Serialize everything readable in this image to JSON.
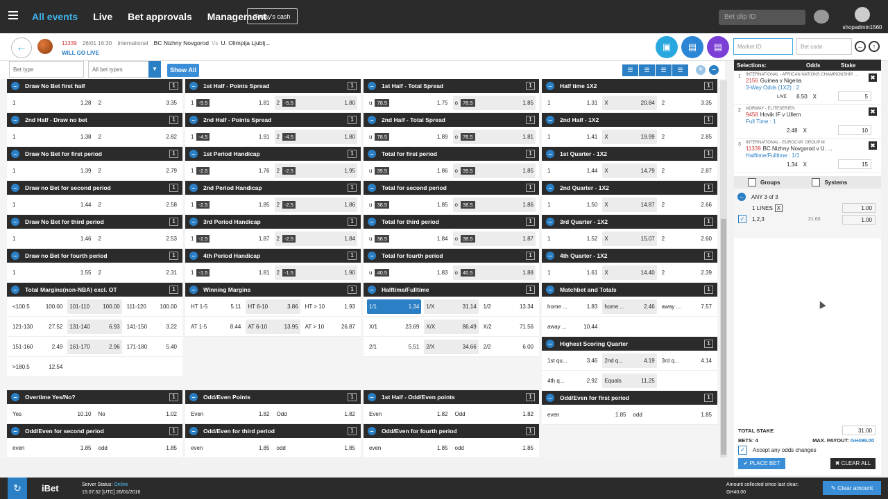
{
  "nav": {
    "items": [
      "All events",
      "Live",
      "Bet approvals",
      "Management"
    ],
    "active": 0,
    "todays_cash": "Today's cash",
    "betslip_placeholder": "Bet slip ID",
    "username": "shopadmin1560"
  },
  "event": {
    "id": "11339",
    "datetime": "26/01 16:30",
    "competition": "International",
    "home": "BC Nizhny Novgorod",
    "vs": "Vs",
    "away": "U. Olimpija Ljublj...",
    "status": "WILL GO LIVE",
    "market_id_placeholder": "Market ID",
    "bet_code_placeholder": "Bet code"
  },
  "filters": {
    "bet_type_placeholder": "Bet type",
    "all_bet_types": "All bet types",
    "show_all": "Show All"
  },
  "colors": {
    "primary": "#2a7fc5",
    "header": "#2b2b2b",
    "round1": "#29a8e0",
    "round2": "#2c86d6",
    "round3": "#7b3fd6"
  },
  "columns": [
    [
      {
        "title": "Draw No Bet first half",
        "count": "1",
        "rows": [
          [
            [
              "1",
              "1.28"
            ],
            [
              "2",
              "3.35"
            ]
          ]
        ]
      },
      {
        "title": "2nd Half - Draw no bet",
        "count": "1",
        "rows": [
          [
            [
              "1",
              "1.38"
            ],
            [
              "2",
              "2.82"
            ]
          ]
        ]
      },
      {
        "title": "Draw No Bet for first period",
        "count": "1",
        "rows": [
          [
            [
              "1",
              "1.39"
            ],
            [
              "2",
              "2.79"
            ]
          ]
        ]
      },
      {
        "title": "Draw no Bet for second period",
        "count": "1",
        "rows": [
          [
            [
              "1",
              "1.44"
            ],
            [
              "2",
              "2.58"
            ]
          ]
        ]
      },
      {
        "title": "Draw No Bet for third period",
        "count": "1",
        "rows": [
          [
            [
              "1",
              "1.46"
            ],
            [
              "2",
              "2.53"
            ]
          ]
        ]
      },
      {
        "title": "Draw no Bet for fourth period",
        "count": "1",
        "rows": [
          [
            [
              "1",
              "1.55"
            ],
            [
              "2",
              "2.31"
            ]
          ]
        ]
      },
      {
        "title": "Total Margins(non-NBA) excl. OT",
        "count": "1",
        "cols": 3,
        "rows": [
          [
            [
              "<100.5",
              "100.00"
            ],
            [
              "101-110",
              "100.00"
            ],
            [
              "111-120",
              "100.00"
            ]
          ],
          [
            [
              "121-130",
              "27.52"
            ],
            [
              "131-140",
              "6.93"
            ],
            [
              "141-150",
              "3.22"
            ]
          ],
          [
            [
              "151-160",
              "2.49"
            ],
            [
              "161-170",
              "2.96"
            ],
            [
              "171-180",
              "5.40"
            ]
          ],
          [
            [
              ">180.5",
              "12.54"
            ]
          ]
        ]
      },
      {
        "title": "Overtime Yes/No?",
        "count": "1",
        "gap": true,
        "rows": [
          [
            [
              "Yes",
              "10.10"
            ],
            [
              "No",
              "1.02"
            ]
          ]
        ]
      },
      {
        "title": "Odd/Even for second period",
        "count": "1",
        "rows": [
          [
            [
              "even",
              "1.85"
            ],
            [
              "odd",
              "1.85"
            ]
          ]
        ]
      }
    ],
    [
      {
        "title": "1st Half - Points Spread",
        "count": "1",
        "rows": [
          [
            [
              "1",
              "-5.5",
              "1.81"
            ],
            [
              "2",
              "-5.5",
              "1.80"
            ]
          ]
        ]
      },
      {
        "title": "2nd Half - Points Spread",
        "count": "1",
        "rows": [
          [
            [
              "1",
              "-4.5",
              "1.91"
            ],
            [
              "2",
              "-4.5",
              "1.80"
            ]
          ]
        ]
      },
      {
        "title": "1st Period Handicap",
        "count": "1",
        "rows": [
          [
            [
              "1",
              "-2.5",
              "1.76"
            ],
            [
              "2",
              "-2.5",
              "1.95"
            ]
          ]
        ]
      },
      {
        "title": "2nd Period Handicap",
        "count": "1",
        "rows": [
          [
            [
              "1",
              "-2.5",
              "1.85"
            ],
            [
              "2",
              "-2.5",
              "1.86"
            ]
          ]
        ]
      },
      {
        "title": "3rd Period Handicap",
        "count": "1",
        "rows": [
          [
            [
              "1",
              "-2.5",
              "1.87"
            ],
            [
              "2",
              "-2.5",
              "1.84"
            ]
          ]
        ]
      },
      {
        "title": "4th Period Handicap",
        "count": "1",
        "rows": [
          [
            [
              "1",
              "-1.5",
              "1.81"
            ],
            [
              "2",
              "-1.5",
              "1.90"
            ]
          ]
        ]
      },
      {
        "title": "Winning Margins",
        "count": "1",
        "cols": 3,
        "rows": [
          [
            [
              "HT 1-5",
              "5.11"
            ],
            [
              "HT 6-10",
              "3.86"
            ],
            [
              "HT > 10",
              "1.93"
            ]
          ],
          [
            [
              "AT 1-5",
              "8.44"
            ],
            [
              "AT 6-10",
              "13.95"
            ],
            [
              "AT > 10",
              "26.87"
            ]
          ]
        ]
      },
      {
        "title": "Odd/Even Points",
        "count": "1",
        "gap": true,
        "rows": [
          [
            [
              "Even",
              "1.82"
            ],
            [
              "Odd",
              "1.82"
            ]
          ]
        ]
      },
      {
        "title": "Odd/Even for third period",
        "count": "1",
        "rows": [
          [
            [
              "even",
              "1.85"
            ],
            [
              "odd",
              "1.85"
            ]
          ]
        ]
      }
    ],
    [
      {
        "title": "1st Half - Total Spread",
        "count": "1",
        "rows": [
          [
            [
              "u",
              "78.5",
              "1.75"
            ],
            [
              "o",
              "78.5",
              "1.85"
            ]
          ]
        ]
      },
      {
        "title": "2nd Half - Total Spread",
        "count": "1",
        "rows": [
          [
            [
              "u",
              "78.5",
              "1.89"
            ],
            [
              "o",
              "78.5",
              "1.81"
            ]
          ]
        ]
      },
      {
        "title": "Total for first period",
        "count": "1",
        "rows": [
          [
            [
              "u",
              "39.5",
              "1.86"
            ],
            [
              "o",
              "39.5",
              "1.85"
            ]
          ]
        ]
      },
      {
        "title": "Total for second period",
        "count": "1",
        "rows": [
          [
            [
              "u",
              "38.5",
              "1.85"
            ],
            [
              "o",
              "38.5",
              "1.86"
            ]
          ]
        ]
      },
      {
        "title": "Total for third period",
        "count": "1",
        "rows": [
          [
            [
              "u",
              "38.5",
              "1.84"
            ],
            [
              "o",
              "38.5",
              "1.87"
            ]
          ]
        ]
      },
      {
        "title": "Total for fourth period",
        "count": "1",
        "rows": [
          [
            [
              "u",
              "40.5",
              "1.83"
            ],
            [
              "o",
              "40.5",
              "1.88"
            ]
          ]
        ]
      },
      {
        "title": "Halftime/Fulltime",
        "count": "1",
        "cols": 3,
        "rows": [
          [
            [
              "1/1",
              "1.34"
            ],
            [
              "1/X",
              "31.14"
            ],
            [
              "1/2",
              "13.34"
            ]
          ],
          [
            [
              "X/1",
              "23.69"
            ],
            [
              "X/X",
              "86.49"
            ],
            [
              "X/2",
              "71.56"
            ]
          ],
          [
            [
              "2/1",
              "5.51"
            ],
            [
              "2/X",
              "34.66"
            ],
            [
              "2/2",
              "6.00"
            ]
          ]
        ]
      },
      {
        "title": "1st Half - Odd/Even points",
        "count": "1",
        "gap": true,
        "rows": [
          [
            [
              "Even",
              "1.82"
            ],
            [
              "Odd",
              "1.82"
            ]
          ]
        ]
      },
      {
        "title": "Odd/Even for fourth period",
        "count": "1",
        "rows": [
          [
            [
              "even",
              "1.85"
            ],
            [
              "odd",
              "1.85"
            ]
          ]
        ]
      }
    ],
    [
      {
        "title": "Half time 1X2",
        "count": "1",
        "cols": 3,
        "rows": [
          [
            [
              "1",
              "1.31"
            ],
            [
              "X",
              "20.84"
            ],
            [
              "2",
              "3.35"
            ]
          ]
        ]
      },
      {
        "title": "2nd Half - 1X2",
        "count": "1",
        "cols": 3,
        "rows": [
          [
            [
              "1",
              "1.41"
            ],
            [
              "X",
              "19.99"
            ],
            [
              "2",
              "2.85"
            ]
          ]
        ]
      },
      {
        "title": "1st Quarter - 1X2",
        "count": "1",
        "cols": 3,
        "rows": [
          [
            [
              "1",
              "1.44"
            ],
            [
              "X",
              "14.79"
            ],
            [
              "2",
              "2.87"
            ]
          ]
        ]
      },
      {
        "title": "2nd Quarter - 1X2",
        "count": "1",
        "cols": 3,
        "rows": [
          [
            [
              "1",
              "1.50"
            ],
            [
              "X",
              "14.87"
            ],
            [
              "2",
              "2.66"
            ]
          ]
        ]
      },
      {
        "title": "3rd Quarter - 1X2",
        "count": "1",
        "cols": 3,
        "rows": [
          [
            [
              "1",
              "1.52"
            ],
            [
              "X",
              "15.07"
            ],
            [
              "2",
              "2.60"
            ]
          ]
        ]
      },
      {
        "title": "4th Quarter - 1X2",
        "count": "1",
        "cols": 3,
        "rows": [
          [
            [
              "1",
              "1.61"
            ],
            [
              "X",
              "14.40"
            ],
            [
              "2",
              "2.39"
            ]
          ]
        ]
      },
      {
        "title": "Matchbet and Totals",
        "count": "1",
        "cols": 3,
        "rows": [
          [
            [
              "home ...",
              "1.83"
            ],
            [
              "home ...",
              "2.46"
            ],
            [
              "away ...",
              "7.57"
            ]
          ],
          [
            [
              "away ...",
              "10.44"
            ]
          ]
        ]
      },
      {
        "title": "Highest Scoring Quarter",
        "count": "1",
        "cols": 3,
        "rows": [
          [
            [
              "1st qu...",
              "3.46"
            ],
            [
              "2nd q...",
              "4.19"
            ],
            [
              "3rd q...",
              "4.14"
            ]
          ],
          [
            [
              "4th q...",
              "2.92"
            ],
            [
              "Equals",
              "11.25"
            ]
          ]
        ]
      },
      {
        "title": "Odd/Even for first period",
        "count": "1",
        "rows": [
          [
            [
              "even",
              "1.85"
            ],
            [
              "odd",
              "1.85"
            ]
          ]
        ]
      }
    ]
  ],
  "slip": {
    "headers": [
      "Selections:",
      "Odds",
      "Stake"
    ],
    "items": [
      {
        "num": "1",
        "comp": "INTERNATIONAL - AFRICAN NATIONS CHAMPIONSHIP, ...",
        "id": "2156",
        "event": "Guinea v Nigeria",
        "market": "3-Way Odds (1X2) : 2",
        "live": "LIVE",
        "odds": "6.50",
        "x": "X",
        "stake": "5"
      },
      {
        "num": "2",
        "comp": "NORWAY - ELITESERIEN",
        "id": "9458",
        "event": "Hovik IF v Ullern",
        "market": "Full Time : 1",
        "live": "",
        "odds": "2.48",
        "x": "X",
        "stake": "10"
      },
      {
        "num": "3",
        "comp": "INTERNATIONAL - EUROCUP, GROUP M",
        "id": "11339",
        "event": "BC Nizhny Novgorod v U. ...",
        "market": "Halftime/Fulltime : 1/1",
        "live": "",
        "odds": "1.34",
        "x": "X",
        "stake": "15"
      }
    ],
    "groups": "Groups",
    "systems": "Systems",
    "any": "ANY 3 of 3",
    "lines": "1 LINES",
    "lines_x": "X",
    "lines_value": "1.00",
    "combo": "1,2,3",
    "combo_odds": "21.60",
    "combo_value": "1.00",
    "total_stake_label": "TOTAL STAKE",
    "total_stake": "31.00",
    "bets": "BETS: 4",
    "max_payout_label": "MAX. PAYOUT:",
    "max_payout": "GH499.00",
    "accept": "Accept any odds changes",
    "place_bet": "✔ PLACE BET",
    "clear_all": "✖ CLEAR ALL"
  },
  "footer": {
    "brand": "iBet",
    "server_label": "Server Status:",
    "server_status": "Online",
    "server_time": "15:07:52 [UTC] 26/01/2016",
    "amount_label": "Amount collected since last clear:",
    "amount": "GH40.00",
    "clear_amount": "Clear amount"
  }
}
